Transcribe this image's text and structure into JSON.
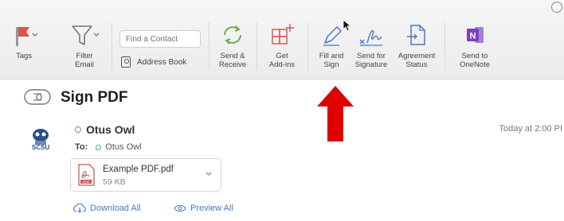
{
  "ribbon": {
    "tags_label": "Tags",
    "filter_label": "Filter\nEmail",
    "find_contact_placeholder": "Find a Contact",
    "address_book_label": "Address Book",
    "send_receive_label": "Send &\nReceive",
    "get_addins_label": "Get\nAdd-ins",
    "fill_sign_label": "Fill and\nSign",
    "send_signature_label": "Send for\nSignature",
    "agreement_status_label": "Agreement\nStatus",
    "onenote_label": "Send to\nOneNote"
  },
  "message": {
    "subject": "Sign PDF",
    "sender": "Otus Owl",
    "to_label": "To:",
    "to_value": "Otus Owl",
    "timestamp": "Today at 2:00 PI",
    "attachment": {
      "name": "Example PDF.pdf",
      "size": "59 KB"
    },
    "download_all": "Download All",
    "preview_all": "Preview All"
  },
  "colors": {
    "arrow": "#e00000",
    "onenote": "#7b3fbf",
    "tags_flag": "#d9534f",
    "link": "#4a78c4",
    "presence": "#4caf50"
  }
}
